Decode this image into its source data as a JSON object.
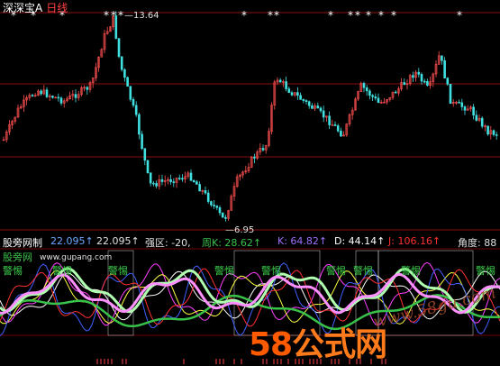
{
  "ticker": {
    "name": "深深宝A",
    "period": "日线"
  },
  "price_panel": {
    "high_label": "13.64",
    "low_label": "6.95",
    "marker_glyph": "*"
  },
  "indicator_bar": {
    "name": "股旁网制",
    "value1": "22.095↑",
    "value2": "22.095↑",
    "strong": "强区: -20,",
    "week": "周K: 28.62↑",
    "k": "K: 64.82↑",
    "d": "D: 44.14↑",
    "j": "J: 106.16↑",
    "angle": "角度: 88"
  },
  "indicator_panel": {
    "site_name": "股旁网",
    "site_url": "www.gupang.com",
    "warning_label": "警惕"
  },
  "watermark": {
    "brand_num": "58",
    "brand_text": "公式网",
    "url": "www.58gu.com"
  },
  "colors": {
    "background": "#000000",
    "up_candle": "#ff5050",
    "down_candle": "#40e0e0",
    "grid_red": "#8a1010",
    "warning_green": "#3cd04a",
    "watermark_orange": "#ff5a00"
  }
}
